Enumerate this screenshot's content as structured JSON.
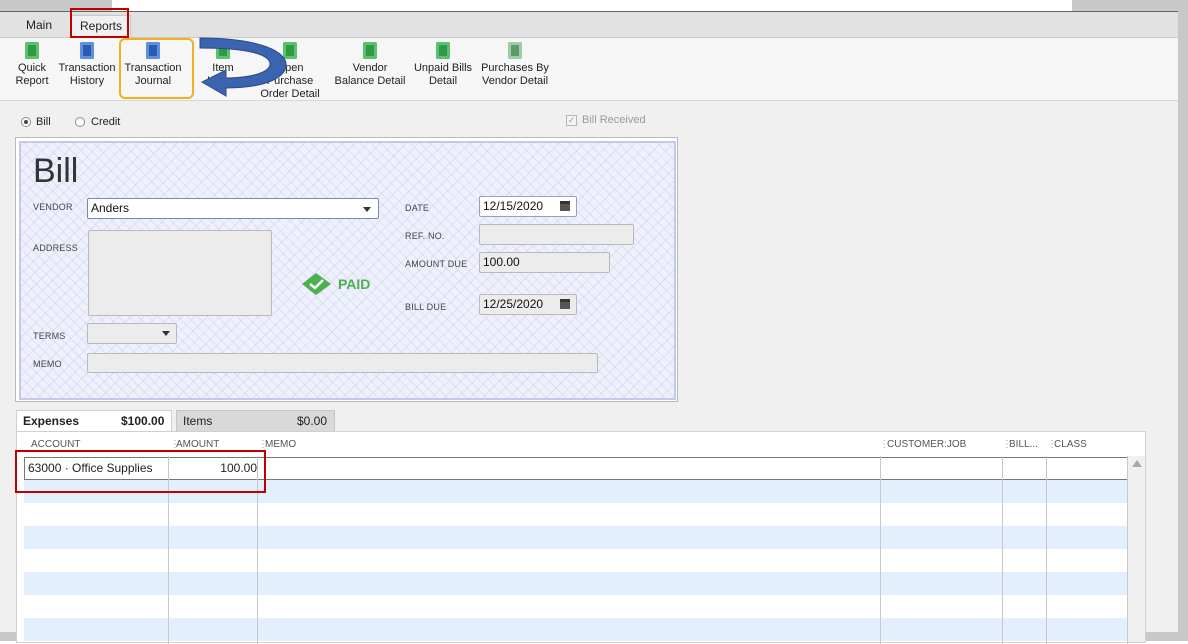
{
  "tabs": [
    "Main",
    "Reports"
  ],
  "toolbar": {
    "buttons": [
      {
        "line1": "Quick",
        "line2": "Report",
        "icon": "report-search-icon"
      },
      {
        "line1": "Transaction",
        "line2": "History",
        "icon": "history-icon"
      },
      {
        "line1": "Transaction",
        "line2": "Journal",
        "icon": "journal-icon"
      },
      {
        "line1": "Item",
        "line2": "Listing",
        "icon": "item-report-icon"
      },
      {
        "line1": "Open Purchase",
        "line2": "Order Detail",
        "icon": "purchase-order-icon"
      },
      {
        "line1": "Vendor",
        "line2": "Balance Detail",
        "icon": "vendor-icon"
      },
      {
        "line1": "Unpaid Bills",
        "line2": "Detail",
        "icon": "spreadsheet-icon"
      },
      {
        "line1": "Purchases By",
        "line2": "Vendor Detail",
        "icon": "chart-icon"
      }
    ]
  },
  "mode": {
    "bill": "Bill",
    "credit": "Credit",
    "selected": "bill",
    "bill_received": "Bill Received",
    "bill_received_checked": true
  },
  "form": {
    "title": "Bill",
    "vendor_label": "VENDOR",
    "vendor_value": "Anders",
    "address_label": "ADDRESS",
    "date_label": "DATE",
    "date_value": "12/15/2020",
    "ref_label": "REF. NO.",
    "ref_value": "",
    "amount_due_label": "AMOUNT DUE",
    "amount_due_value": "100.00",
    "paid_stamp": "PAID",
    "bill_due_label": "BILL DUE",
    "bill_due_value": "12/25/2020",
    "terms_label": "TERMS",
    "terms_value": "",
    "memo_label": "MEMO",
    "memo_value": ""
  },
  "detail_tabs": {
    "expenses_label": "Expenses",
    "expenses_total": "$100.00",
    "items_label": "Items",
    "items_total": "$0.00"
  },
  "grid": {
    "columns": [
      "ACCOUNT",
      "AMOUNT",
      "MEMO",
      "CUSTOMER:JOB",
      "BILL...",
      "CLASS"
    ],
    "rows": [
      {
        "account": "63000 · Office Supplies",
        "amount": "100.00"
      }
    ]
  },
  "colors": {
    "highlight_red": "#c00000",
    "highlight_orange": "#f2b11a",
    "arrow_blue": "#3a64b0",
    "paid_green": "#4caf50"
  }
}
